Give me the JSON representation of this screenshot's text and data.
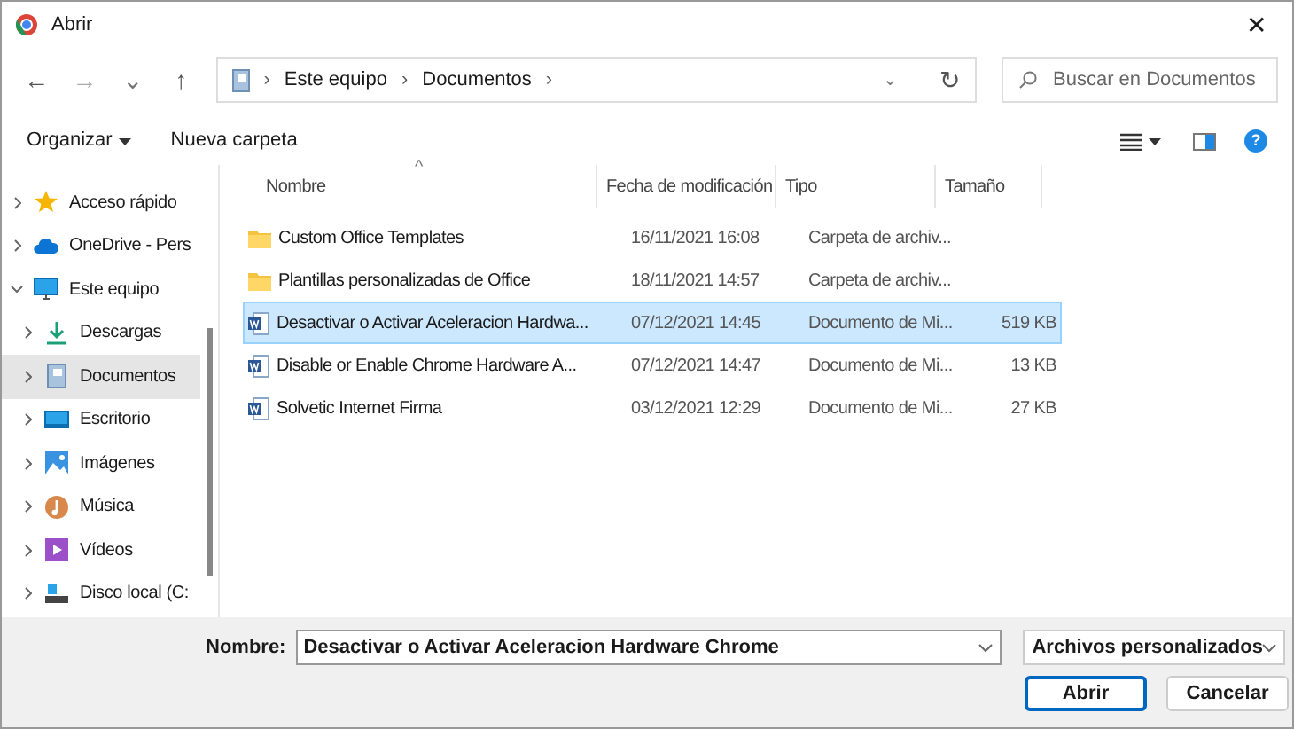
{
  "window": {
    "title": "Abrir",
    "close": "✕"
  },
  "nav": {
    "back": "←",
    "forward": "→",
    "recent": "⌄",
    "up": "↑",
    "breadcrumb": [
      "Este equipo",
      "Documentos"
    ],
    "separator": "›",
    "dropdown": "⌄",
    "refresh": "↻"
  },
  "search": {
    "placeholder": "Buscar en Documentos"
  },
  "toolbar": {
    "organize": "Organizar",
    "new_folder": "Nueva carpeta",
    "help": "?"
  },
  "sidebar": {
    "items": [
      {
        "label": "Acceso rápido",
        "kind": "star",
        "expanded": false,
        "selected": false
      },
      {
        "label": "OneDrive - Pers",
        "kind": "cloud",
        "expanded": false,
        "selected": false
      },
      {
        "label": "Este equipo",
        "kind": "pc",
        "expanded": true,
        "selected": false,
        "children": [
          {
            "label": "Descargas",
            "kind": "download",
            "expanded": false,
            "selected": false
          },
          {
            "label": "Documentos",
            "kind": "docs",
            "expanded": false,
            "selected": true
          },
          {
            "label": "Escritorio",
            "kind": "desktop",
            "expanded": false,
            "selected": false
          },
          {
            "label": "Imágenes",
            "kind": "images",
            "expanded": false,
            "selected": false
          },
          {
            "label": "Música",
            "kind": "music",
            "expanded": false,
            "selected": false
          },
          {
            "label": "Vídeos",
            "kind": "videos",
            "expanded": false,
            "selected": false
          },
          {
            "label": "Disco local (C:",
            "kind": "drive",
            "expanded": false,
            "selected": false
          }
        ]
      }
    ]
  },
  "table": {
    "sort_arrow": "^",
    "columns": [
      "Nombre",
      "Fecha de modificación",
      "Tipo",
      "Tamaño"
    ],
    "rows": [
      {
        "kind": "folder",
        "name": "Custom Office Templates",
        "date": "16/11/2021 16:08",
        "type": "Carpeta de archiv...",
        "size": "",
        "selected": false
      },
      {
        "kind": "folder",
        "name": "Plantillas personalizadas de Office",
        "date": "18/11/2021 14:57",
        "type": "Carpeta de archiv...",
        "size": "",
        "selected": false
      },
      {
        "kind": "word",
        "name": "Desactivar o Activar Aceleracion Hardwa...",
        "date": "07/12/2021 14:45",
        "type": "Documento de Mi...",
        "size": "519 KB",
        "selected": true
      },
      {
        "kind": "word",
        "name": "Disable or Enable Chrome Hardware A...",
        "date": "07/12/2021 14:47",
        "type": "Documento de Mi...",
        "size": "13 KB",
        "selected": false
      },
      {
        "kind": "word",
        "name": "Solvetic Internet Firma",
        "date": "03/12/2021 12:29",
        "type": "Documento de Mi...",
        "size": "27 KB",
        "selected": false
      }
    ]
  },
  "footer": {
    "name_label": "Nombre:",
    "name_value": "Desactivar o Activar Aceleracion Hardware Chrome",
    "filter": "Archivos personalizados",
    "open": "Abrir",
    "cancel": "Cancelar"
  }
}
